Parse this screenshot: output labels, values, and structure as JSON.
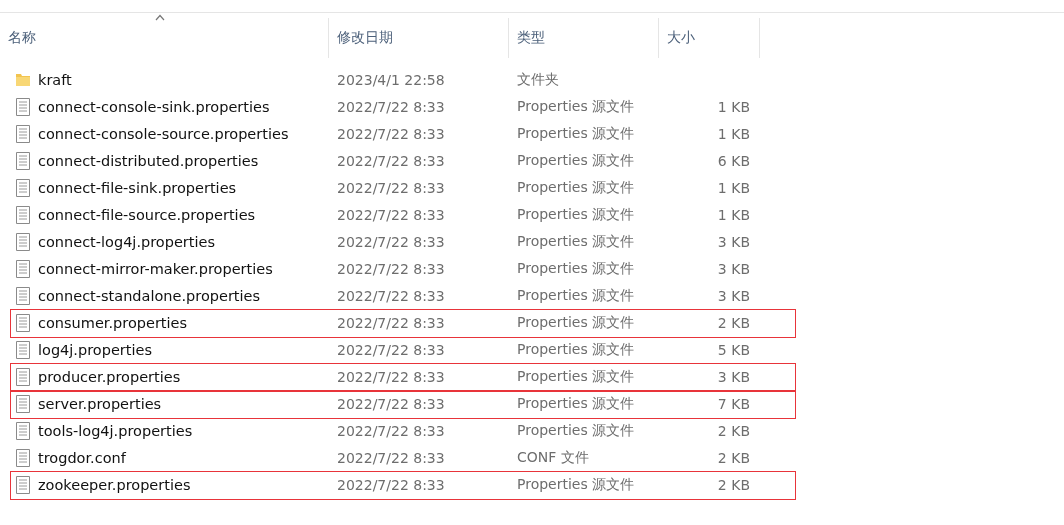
{
  "columns": [
    {
      "label": "名称",
      "sorted": true
    },
    {
      "label": "修改日期",
      "sorted": false
    },
    {
      "label": "类型",
      "sorted": false
    },
    {
      "label": "大小",
      "sorted": false
    }
  ],
  "rows": [
    {
      "kind": "folder",
      "name": "kraft",
      "date": "2023/4/1 22:58",
      "type": "文件夹",
      "size": "",
      "highlighted": false
    },
    {
      "kind": "file",
      "name": "connect-console-sink.properties",
      "date": "2022/7/22 8:33",
      "type": "Properties 源文件",
      "size": "1 KB",
      "highlighted": false
    },
    {
      "kind": "file",
      "name": "connect-console-source.properties",
      "date": "2022/7/22 8:33",
      "type": "Properties 源文件",
      "size": "1 KB",
      "highlighted": false
    },
    {
      "kind": "file",
      "name": "connect-distributed.properties",
      "date": "2022/7/22 8:33",
      "type": "Properties 源文件",
      "size": "6 KB",
      "highlighted": false
    },
    {
      "kind": "file",
      "name": "connect-file-sink.properties",
      "date": "2022/7/22 8:33",
      "type": "Properties 源文件",
      "size": "1 KB",
      "highlighted": false
    },
    {
      "kind": "file",
      "name": "connect-file-source.properties",
      "date": "2022/7/22 8:33",
      "type": "Properties 源文件",
      "size": "1 KB",
      "highlighted": false
    },
    {
      "kind": "file",
      "name": "connect-log4j.properties",
      "date": "2022/7/22 8:33",
      "type": "Properties 源文件",
      "size": "3 KB",
      "highlighted": false
    },
    {
      "kind": "file",
      "name": "connect-mirror-maker.properties",
      "date": "2022/7/22 8:33",
      "type": "Properties 源文件",
      "size": "3 KB",
      "highlighted": false
    },
    {
      "kind": "file",
      "name": "connect-standalone.properties",
      "date": "2022/7/22 8:33",
      "type": "Properties 源文件",
      "size": "3 KB",
      "highlighted": false
    },
    {
      "kind": "file",
      "name": "consumer.properties",
      "date": "2022/7/22 8:33",
      "type": "Properties 源文件",
      "size": "2 KB",
      "highlighted": true
    },
    {
      "kind": "file",
      "name": "log4j.properties",
      "date": "2022/7/22 8:33",
      "type": "Properties 源文件",
      "size": "5 KB",
      "highlighted": false
    },
    {
      "kind": "file",
      "name": "producer.properties",
      "date": "2022/7/22 8:33",
      "type": "Properties 源文件",
      "size": "3 KB",
      "highlighted": true
    },
    {
      "kind": "file",
      "name": "server.properties",
      "date": "2022/7/22 8:33",
      "type": "Properties 源文件",
      "size": "7 KB",
      "highlighted": true
    },
    {
      "kind": "file",
      "name": "tools-log4j.properties",
      "date": "2022/7/22 8:33",
      "type": "Properties 源文件",
      "size": "2 KB",
      "highlighted": false
    },
    {
      "kind": "file",
      "name": "trogdor.conf",
      "date": "2022/7/22 8:33",
      "type": "CONF 文件",
      "size": "2 KB",
      "highlighted": false
    },
    {
      "kind": "file",
      "name": "zookeeper.properties",
      "date": "2022/7/22 8:33",
      "type": "Properties 源文件",
      "size": "2 KB",
      "highlighted": true
    }
  ]
}
